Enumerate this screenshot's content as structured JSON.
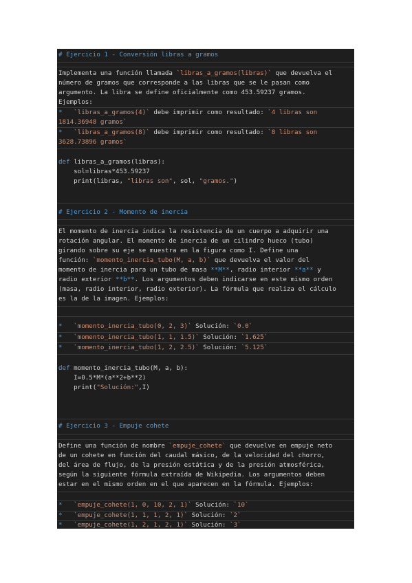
{
  "ex1": {
    "heading": "# Ejercicio 1 - Conversión libras a gramos",
    "p1a": "Implementa una función llamada ",
    "p1b": "`libras_a_gramos(libras)`",
    "p1c": " que devuelva el",
    "p2": "número de gramos que corresponde a las libras que se le pasan como",
    "p3": "argumento. La libra se define oficialmente como 453.59237 gramos.",
    "p4": "Ejemplos:",
    "b1a": "*   ",
    "b1b": "`libras_a_gramos(4)`",
    "b1c": " debe imprimir como resultado: ",
    "b1d": "`4 libras son",
    "b1e": "1814.36948 gramos`",
    "b2a": "*   ",
    "b2b": "`libras_a_gramos(8)`",
    "b2c": " debe imprimir como resultado: ",
    "b2d": "`8 libras son",
    "b2e": "3628.73896 gramos`",
    "code1a": "def",
    "code1b": " libras_a_gramos(libras):",
    "code2": "    sol=libras*453.59237",
    "code3a": "    print(libras, ",
    "code3b": "\"libras son\"",
    "code3c": ", sol, ",
    "code3d": "\"gramos.\"",
    "code3e": ")"
  },
  "ex2": {
    "heading": "# Ejercicio 2 - Momento de inercia",
    "p1": "El momento de inercia indica la resistencia de un cuerpo a adquirir una",
    "p2": "rotación angular. El momento de inercia de un cilindro hueco (tubo)",
    "p3": "girando sobre su eje se muestra en la figura como I. Define una",
    "p4a": "función: ",
    "p4b": "`momento_inercia_tubo(M, a, b)`",
    "p4c": " que devuelva el valor del",
    "p5a": "momento de inercia para un tubo de masa ",
    "p5b": "**M**",
    "p5c": ", radio interior ",
    "p5d": "**a**",
    "p5e": " y",
    "p6a": "radio exterior ",
    "p6b": "**b**",
    "p6c": ". Los argumentos deben indicarse en este mismo orden",
    "p7": "(masa, radio interior, radio exterior). La fórmula que realiza el cálculo",
    "p8": "es la de la imagen. Ejemplos:",
    "e1a": "*   ",
    "e1b": "`momento_inercia_tubo(0, 2, 3)`",
    "e1c": " Solución: ",
    "e1d": "`0.0`",
    "e2a": "*   ",
    "e2b": "`momento_inercia_tubo(1, 1, 1.5)`",
    "e2c": " Solución: ",
    "e2d": "`1.625`",
    "e3a": "*   ",
    "e3b": "`momento_inercia_tubo(1, 2, 2.5)`",
    "e3c": " Solución: ",
    "e3d": "`5.125`",
    "code1a": "def",
    "code1b": " momento_inercia_tubo(M, a, b):",
    "code2": "    I=0.5*M*(a**2+b**2)",
    "code3a": "    print(",
    "code3b": "\"Solución:\"",
    "code3c": ",I)"
  },
  "ex3": {
    "heading": "# Ejercicio 3 - Empuje cohete",
    "p1a": "Define una función de nombre ",
    "p1b": "`empuje_cohete`",
    "p1c": " que devuelve en empuje neto",
    "p2": "de un cohete en función del caudal másico, de la velocidad del chorro,",
    "p3": "del área de flujo, de la presión estática y de la presión atmosférica,",
    "p4": "según la siguiente fórmula extraída de Wikipedia. Los argumentos deben",
    "p5": "estar en el mismo orden en el que aparecen en la fórmula. Ejemplos:",
    "e1a": "*   ",
    "e1b": "`empuje_cohete(1, 0, 10, 2, 1)`",
    "e1c": " Solución: ",
    "e1d": "`10`",
    "e2a": "*   ",
    "e2b": "`empuje_cohete(1, 1, 1, 2, 1)`",
    "e2c": " Solución: ",
    "e2d": "`2`",
    "e3a": "*   ",
    "e3b": "`empuje_cohete(1, 2, 1, 2, 1)`",
    "e3c": " Solución: ",
    "e3d": "`3`"
  }
}
